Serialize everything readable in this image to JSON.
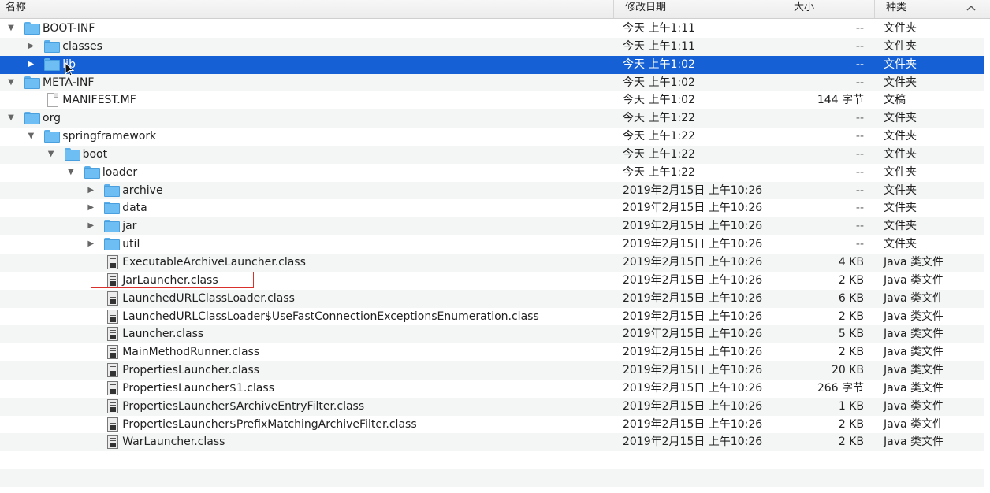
{
  "columns": {
    "name": "名称",
    "date": "修改日期",
    "size": "大小",
    "kind": "种类",
    "sort_indicator": "^"
  },
  "rows": [
    {
      "depth": 0,
      "disclosure": "expanded",
      "icon": "folder-icon",
      "name": "BOOT-INF",
      "date": "今天 上午1:11",
      "size": "--",
      "kind": "文件夹"
    },
    {
      "depth": 1,
      "disclosure": "collapsed",
      "icon": "folder-icon",
      "name": "classes",
      "date": "今天 上午1:11",
      "size": "--",
      "kind": "文件夹"
    },
    {
      "depth": 1,
      "disclosure": "collapsed",
      "icon": "folder-icon",
      "name": "lib",
      "date": "今天 上午1:02",
      "size": "--",
      "kind": "文件夹",
      "selected": true
    },
    {
      "depth": 0,
      "disclosure": "expanded",
      "icon": "folder-icon",
      "name": "META-INF",
      "date": "今天 上午1:02",
      "size": "--",
      "kind": "文件夹"
    },
    {
      "depth": 1,
      "disclosure": "none",
      "icon": "file-icon",
      "name": "MANIFEST.MF",
      "date": "今天 上午1:02",
      "size": "144 字节",
      "kind": "文稿"
    },
    {
      "depth": 0,
      "disclosure": "expanded",
      "icon": "folder-icon",
      "name": "org",
      "date": "今天 上午1:22",
      "size": "--",
      "kind": "文件夹"
    },
    {
      "depth": 1,
      "disclosure": "expanded",
      "icon": "folder-icon",
      "name": "springframework",
      "date": "今天 上午1:22",
      "size": "--",
      "kind": "文件夹"
    },
    {
      "depth": 2,
      "disclosure": "expanded",
      "icon": "folder-icon",
      "name": "boot",
      "date": "今天 上午1:22",
      "size": "--",
      "kind": "文件夹"
    },
    {
      "depth": 3,
      "disclosure": "expanded",
      "icon": "folder-icon",
      "name": "loader",
      "date": "今天 上午1:22",
      "size": "--",
      "kind": "文件夹"
    },
    {
      "depth": 4,
      "disclosure": "collapsed",
      "icon": "folder-icon",
      "name": "archive",
      "date": "2019年2月15日 上午10:26",
      "size": "--",
      "kind": "文件夹"
    },
    {
      "depth": 4,
      "disclosure": "collapsed",
      "icon": "folder-icon",
      "name": "data",
      "date": "2019年2月15日 上午10:26",
      "size": "--",
      "kind": "文件夹"
    },
    {
      "depth": 4,
      "disclosure": "collapsed",
      "icon": "folder-icon",
      "name": "jar",
      "date": "2019年2月15日 上午10:26",
      "size": "--",
      "kind": "文件夹"
    },
    {
      "depth": 4,
      "disclosure": "collapsed",
      "icon": "folder-icon",
      "name": "util",
      "date": "2019年2月15日 上午10:26",
      "size": "--",
      "kind": "文件夹"
    },
    {
      "depth": 4,
      "disclosure": "none",
      "icon": "class-file-icon",
      "name": "ExecutableArchiveLauncher.class",
      "date": "2019年2月15日 上午10:26",
      "size": "4 KB",
      "kind": "Java 类文件"
    },
    {
      "depth": 4,
      "disclosure": "none",
      "icon": "class-file-icon",
      "name": "JarLauncher.class",
      "date": "2019年2月15日 上午10:26",
      "size": "2 KB",
      "kind": "Java 类文件"
    },
    {
      "depth": 4,
      "disclosure": "none",
      "icon": "class-file-icon",
      "name": "LaunchedURLClassLoader.class",
      "date": "2019年2月15日 上午10:26",
      "size": "6 KB",
      "kind": "Java 类文件"
    },
    {
      "depth": 4,
      "disclosure": "none",
      "icon": "class-file-icon",
      "name": "LaunchedURLClassLoader$UseFastConnectionExceptionsEnumeration.class",
      "date": "2019年2月15日 上午10:26",
      "size": "2 KB",
      "kind": "Java 类文件"
    },
    {
      "depth": 4,
      "disclosure": "none",
      "icon": "class-file-icon",
      "name": "Launcher.class",
      "date": "2019年2月15日 上午10:26",
      "size": "5 KB",
      "kind": "Java 类文件"
    },
    {
      "depth": 4,
      "disclosure": "none",
      "icon": "class-file-icon",
      "name": "MainMethodRunner.class",
      "date": "2019年2月15日 上午10:26",
      "size": "2 KB",
      "kind": "Java 类文件"
    },
    {
      "depth": 4,
      "disclosure": "none",
      "icon": "class-file-icon",
      "name": "PropertiesLauncher.class",
      "date": "2019年2月15日 上午10:26",
      "size": "20 KB",
      "kind": "Java 类文件"
    },
    {
      "depth": 4,
      "disclosure": "none",
      "icon": "class-file-icon",
      "name": "PropertiesLauncher$1.class",
      "date": "2019年2月15日 上午10:26",
      "size": "266 字节",
      "kind": "Java 类文件"
    },
    {
      "depth": 4,
      "disclosure": "none",
      "icon": "class-file-icon",
      "name": "PropertiesLauncher$ArchiveEntryFilter.class",
      "date": "2019年2月15日 上午10:26",
      "size": "1 KB",
      "kind": "Java 类文件"
    },
    {
      "depth": 4,
      "disclosure": "none",
      "icon": "class-file-icon",
      "name": "PropertiesLauncher$PrefixMatchingArchiveFilter.class",
      "date": "2019年2月15日 上午10:26",
      "size": "2 KB",
      "kind": "Java 类文件"
    },
    {
      "depth": 4,
      "disclosure": "none",
      "icon": "class-file-icon",
      "name": "WarLauncher.class",
      "date": "2019年2月15日 上午10:26",
      "size": "2 KB",
      "kind": "Java 类文件"
    }
  ],
  "colors": {
    "selection": "#1560d4",
    "alt_row": "#f4f5f5",
    "highlight_box": "#d9302b",
    "folder": "#6fbef3"
  }
}
